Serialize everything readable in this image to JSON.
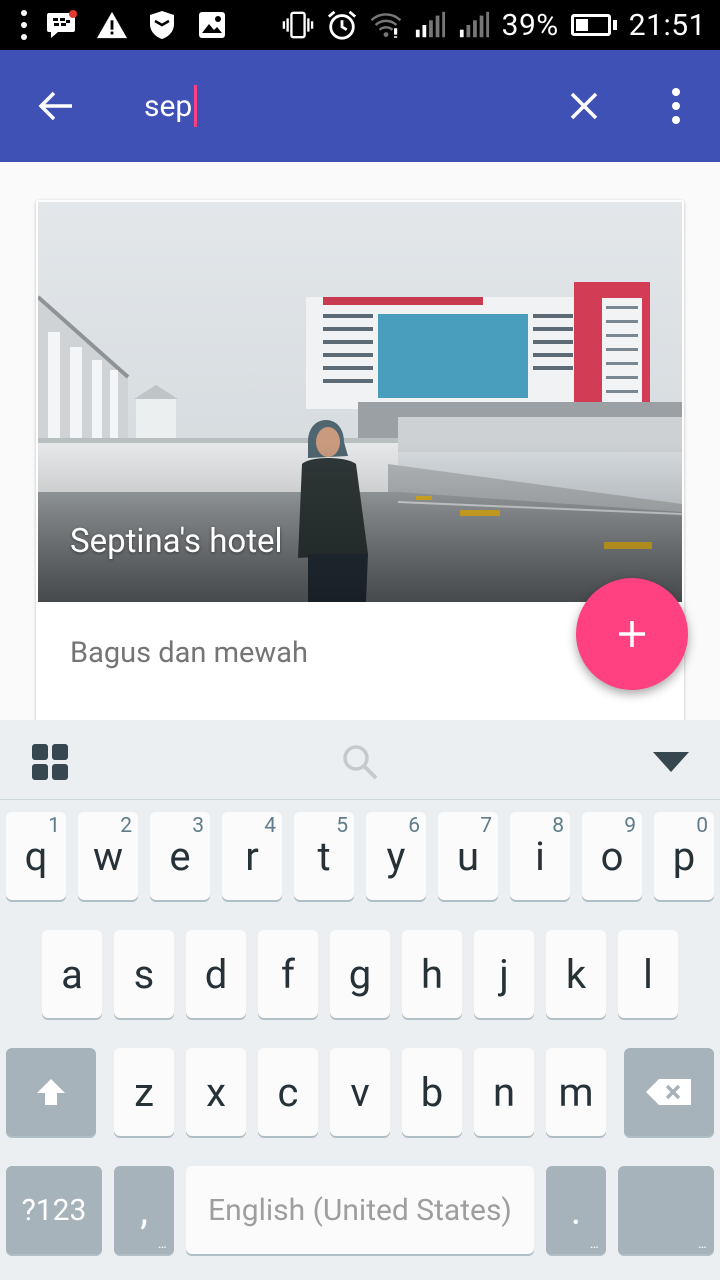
{
  "statusbar": {
    "battery_percent": "39%",
    "time": "21:51",
    "icons": [
      "overflow-dots-icon",
      "bbm-notification-icon",
      "warning-icon",
      "shield-icon",
      "image-icon",
      "vibrate-icon",
      "alarm-icon",
      "wifi-icon",
      "signal-icon",
      "signal-icon-2",
      "battery-icon"
    ]
  },
  "appbar": {
    "query": "sep",
    "background": "#3f51b5",
    "cursor_color": "#ff4081"
  },
  "card": {
    "title": "Septina's hotel",
    "description": "Bagus dan mewah"
  },
  "fab": {
    "label": "+",
    "color": "#ff4081"
  },
  "keyboard": {
    "row1": [
      {
        "ch": "q",
        "hint": "1"
      },
      {
        "ch": "w",
        "hint": "2"
      },
      {
        "ch": "e",
        "hint": "3"
      },
      {
        "ch": "r",
        "hint": "4"
      },
      {
        "ch": "t",
        "hint": "5"
      },
      {
        "ch": "y",
        "hint": "6"
      },
      {
        "ch": "u",
        "hint": "7"
      },
      {
        "ch": "i",
        "hint": "8"
      },
      {
        "ch": "o",
        "hint": "9"
      },
      {
        "ch": "p",
        "hint": "0"
      }
    ],
    "row2": [
      "a",
      "s",
      "d",
      "f",
      "g",
      "h",
      "j",
      "k",
      "l"
    ],
    "row3": [
      "z",
      "x",
      "c",
      "v",
      "b",
      "n",
      "m"
    ],
    "symbols_label": "?123",
    "comma_label": ",",
    "space_label": "English (United States)",
    "period_label": ".",
    "more_marker": "..."
  }
}
